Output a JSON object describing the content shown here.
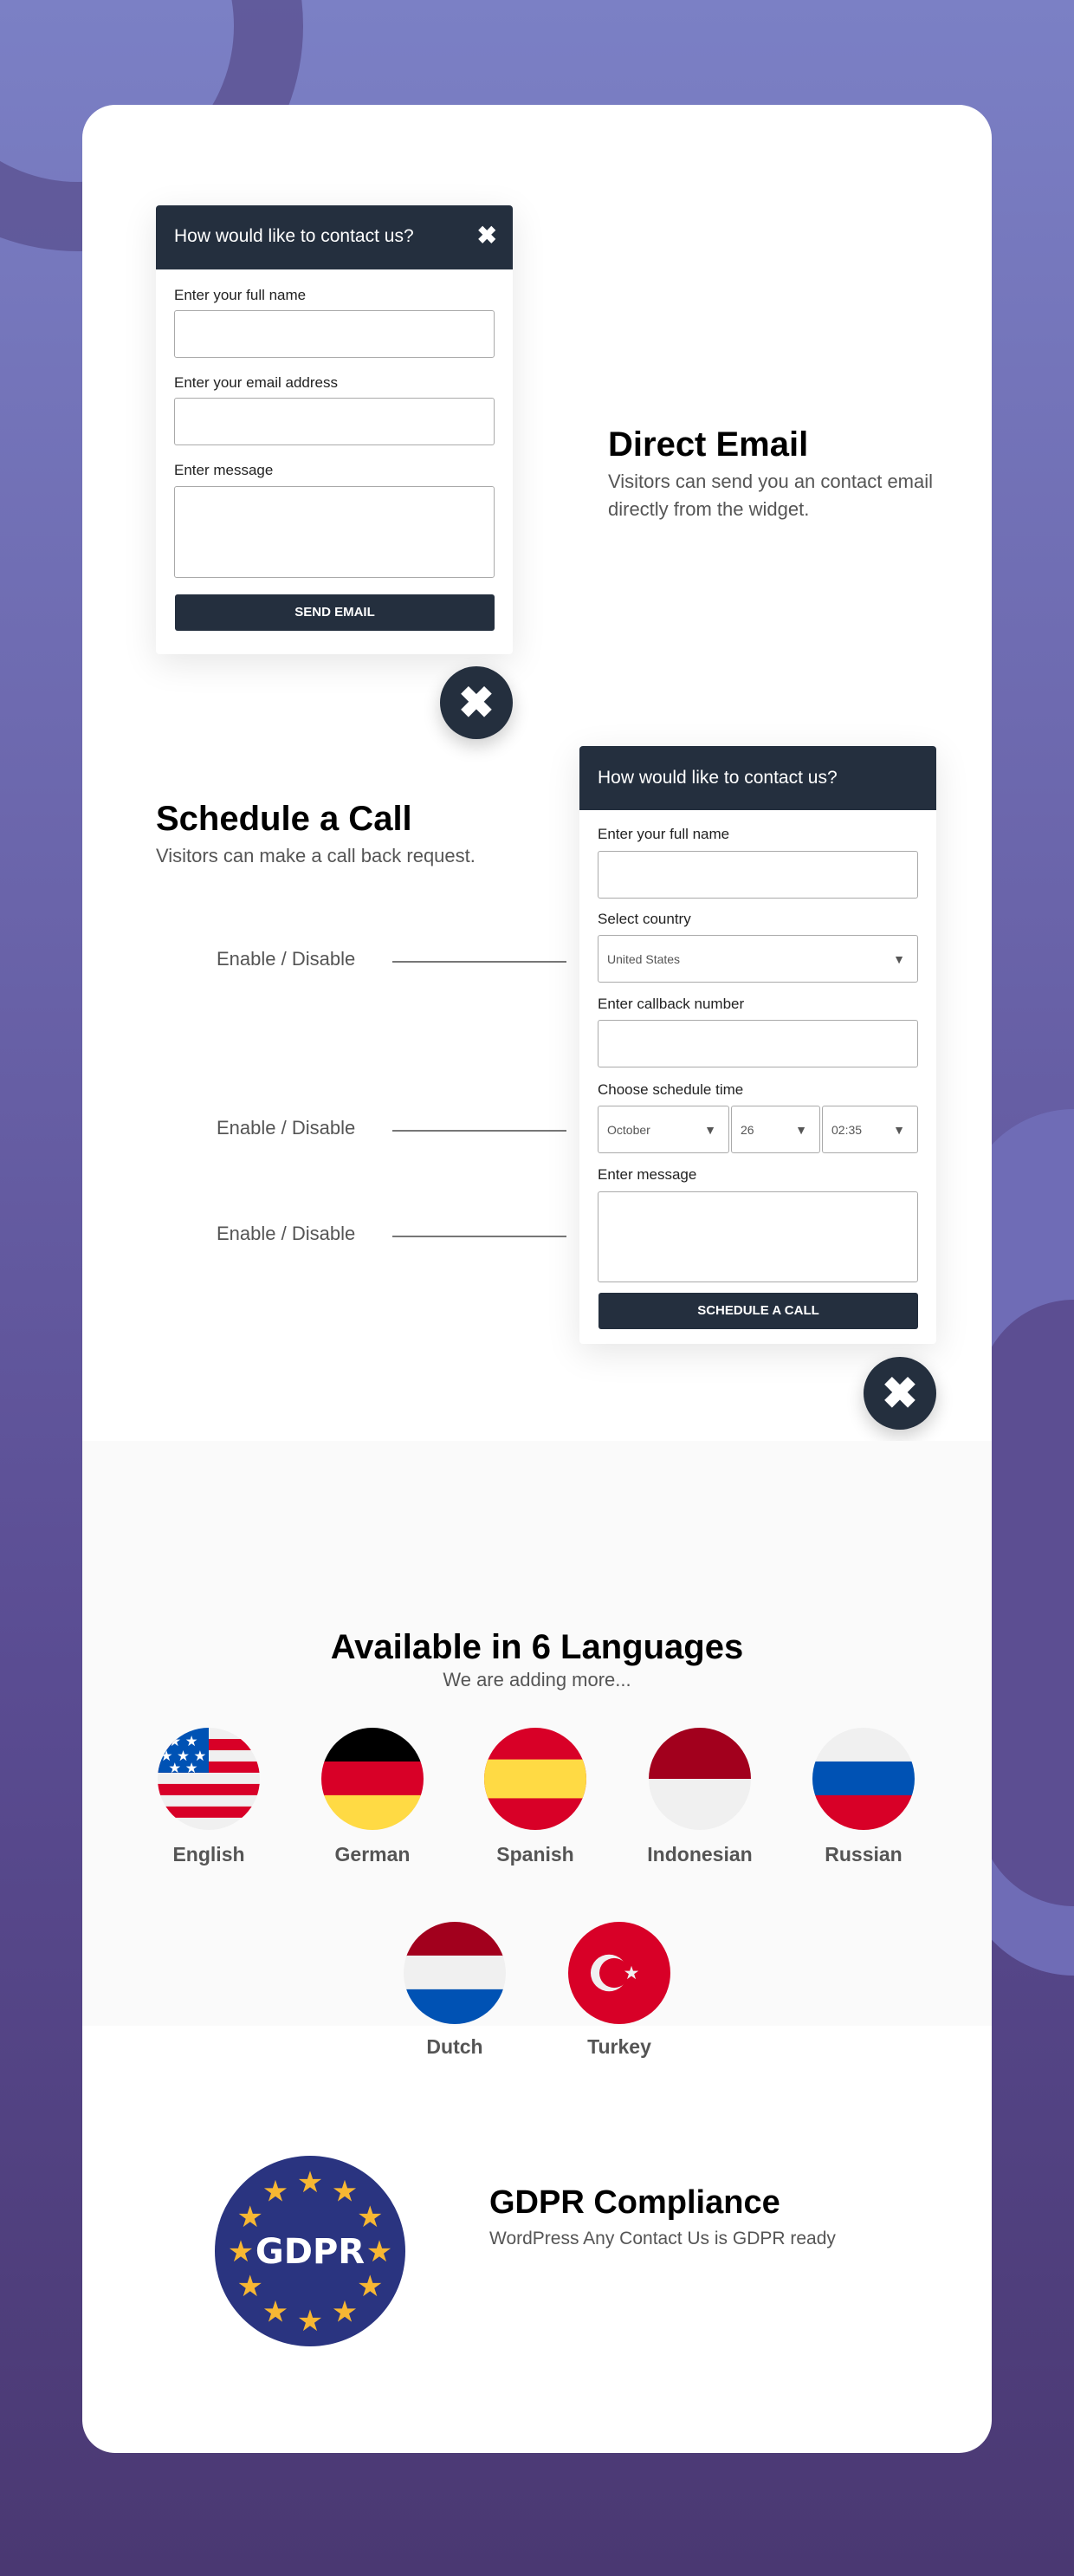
{
  "direct_email": {
    "widget": {
      "title": "How would like to contact us?",
      "close_icon": "close-icon",
      "fields": [
        {
          "label": "Enter your full name",
          "value": ""
        },
        {
          "label": "Enter your email address",
          "value": ""
        },
        {
          "label": "Enter message",
          "value": ""
        }
      ],
      "submit_label": "SEND EMAIL"
    },
    "title": "Direct Email",
    "description": "Visitors can send you an contact email directly from the widget."
  },
  "schedule_call": {
    "title": "Schedule a Call",
    "description": "Visitors can make a call back request.",
    "toggles": [
      "Enable / Disable",
      "Enable / Disable",
      "Enable / Disable"
    ],
    "widget": {
      "title": "How would like to contact us?",
      "name_label": "Enter your full name",
      "country_label": "Select country",
      "country_value": "United States",
      "callback_label": "Enter callback number",
      "schedule_label": "Choose schedule time",
      "month_value": "October",
      "day_value": "26",
      "time_value": "02:35",
      "message_label": "Enter message",
      "submit_label": "SCHEDULE A CALL"
    }
  },
  "languages": {
    "title": "Available in 6 Languages",
    "subtitle": "We are adding more...",
    "items": [
      "English",
      "German",
      "Spanish",
      "Indonesian",
      "Russian",
      "Dutch",
      "Turkey"
    ]
  },
  "gdpr": {
    "badge_text": "GDPR",
    "title": "GDPR Compliance",
    "description": "WordPress Any Contact Us is GDPR ready"
  },
  "colors": {
    "dark": "#242f3e",
    "purple_top": "#7b80c5",
    "purple_bottom": "#4a3872",
    "gdpr_blue": "#2a3480",
    "star": "#f7b733"
  }
}
